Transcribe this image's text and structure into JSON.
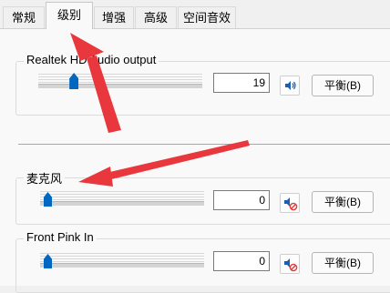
{
  "tabs": [
    {
      "label": "常规"
    },
    {
      "label": "级别"
    },
    {
      "label": "增强"
    },
    {
      "label": "高级"
    },
    {
      "label": "空间音效"
    }
  ],
  "active_tab": "级别",
  "devices": [
    {
      "name": "Realtek HD Audio output",
      "level": "19",
      "slider_fraction": 0.19,
      "muted": false,
      "balance_label": "平衡(B)"
    },
    {
      "name": "麦克风",
      "level": "0",
      "slider_fraction": 0.0,
      "muted": true,
      "balance_label": "平衡(B)"
    },
    {
      "name": "Front Pink In",
      "level": "0",
      "slider_fraction": 0.0,
      "muted": true,
      "balance_label": "平衡(B)"
    }
  ],
  "colors": {
    "accent": "#0067c0",
    "annotation_arrow": "#e8383d",
    "mute_indicator": "#e23a3a"
  },
  "icons": {
    "speaker": "speaker-icon",
    "speaker_muted": "speaker-muted-icon"
  }
}
